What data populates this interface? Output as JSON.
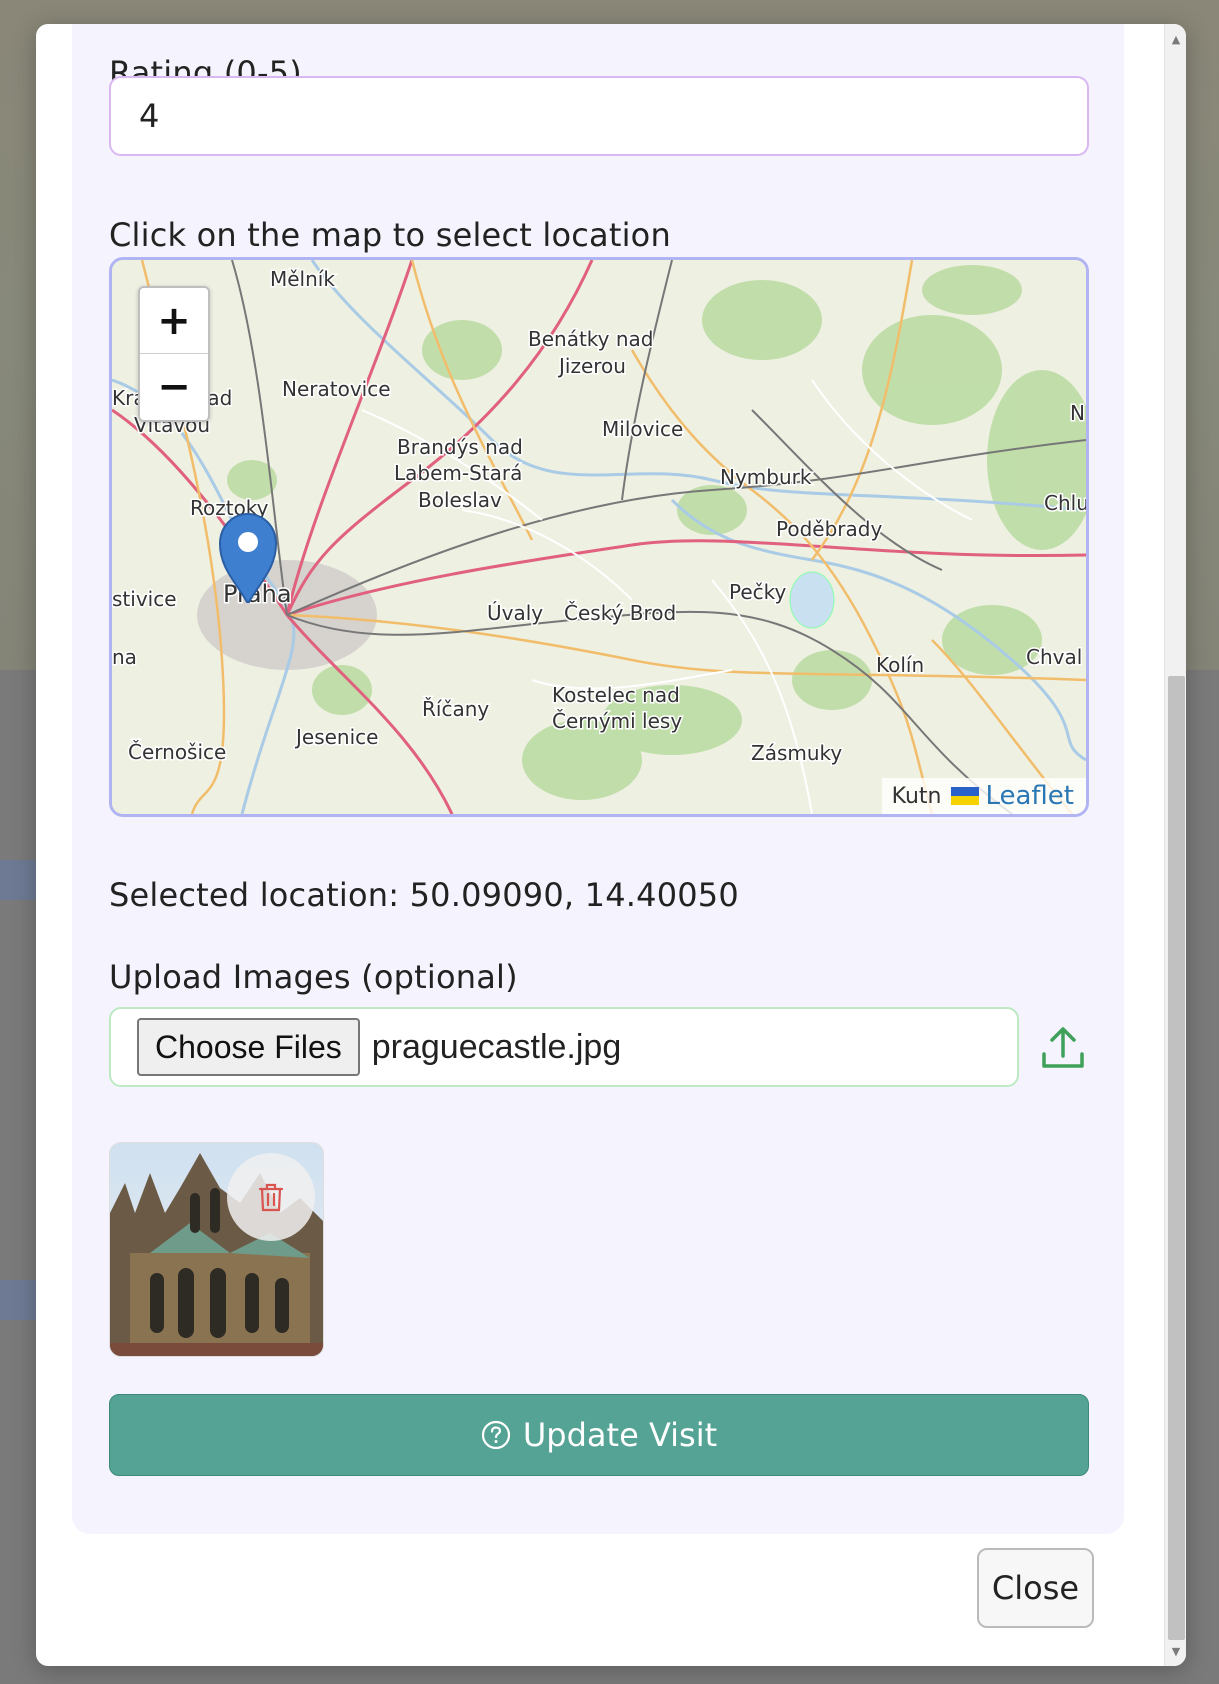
{
  "form": {
    "rating_label": "Rating (0-5)",
    "rating_value": "4",
    "map_label": "Click on the map to select location",
    "selected_location": "Selected location: 50.09090, 14.40050",
    "upload_label": "Upload Images (optional)",
    "choose_files_label": "Choose Files",
    "file_name": "praguecastle.jpg",
    "update_button_label": "Update Visit"
  },
  "map": {
    "zoom_in_label": "+",
    "zoom_out_label": "−",
    "attribution": "Leaflet",
    "attribution_partial": "Kutn",
    "marker_lat": 50.0909,
    "marker_lng": 14.4005,
    "place_labels": [
      "Mělník",
      "Benátky nad",
      "Jizerou",
      "Neratovice",
      "Kralupy nad",
      "Vltavou",
      "Milovice",
      "Brandýs nad",
      "Labem-Stará",
      "Boleslav",
      "Nymburk",
      "Poděbrady",
      "Roztoky",
      "Praha",
      "Úvaly",
      "Český Brod",
      "Pečky",
      "Kolín",
      "Chval",
      "Chlu",
      "Kostelec nad",
      "Černými lesy",
      "Říčany",
      "Jesenice",
      "Černošice",
      "Zásmuky",
      "stivice",
      "na",
      "N"
    ]
  },
  "footer": {
    "close_label": "Close"
  },
  "colors": {
    "card_bg": "#f5f3fd",
    "rating_border": "#d8b8ef",
    "map_border": "#b1b4f2",
    "file_border": "#bdeac4",
    "update_button": "#54a394",
    "upload_icon": "#3fa05a",
    "trash_icon": "#d9534f"
  }
}
